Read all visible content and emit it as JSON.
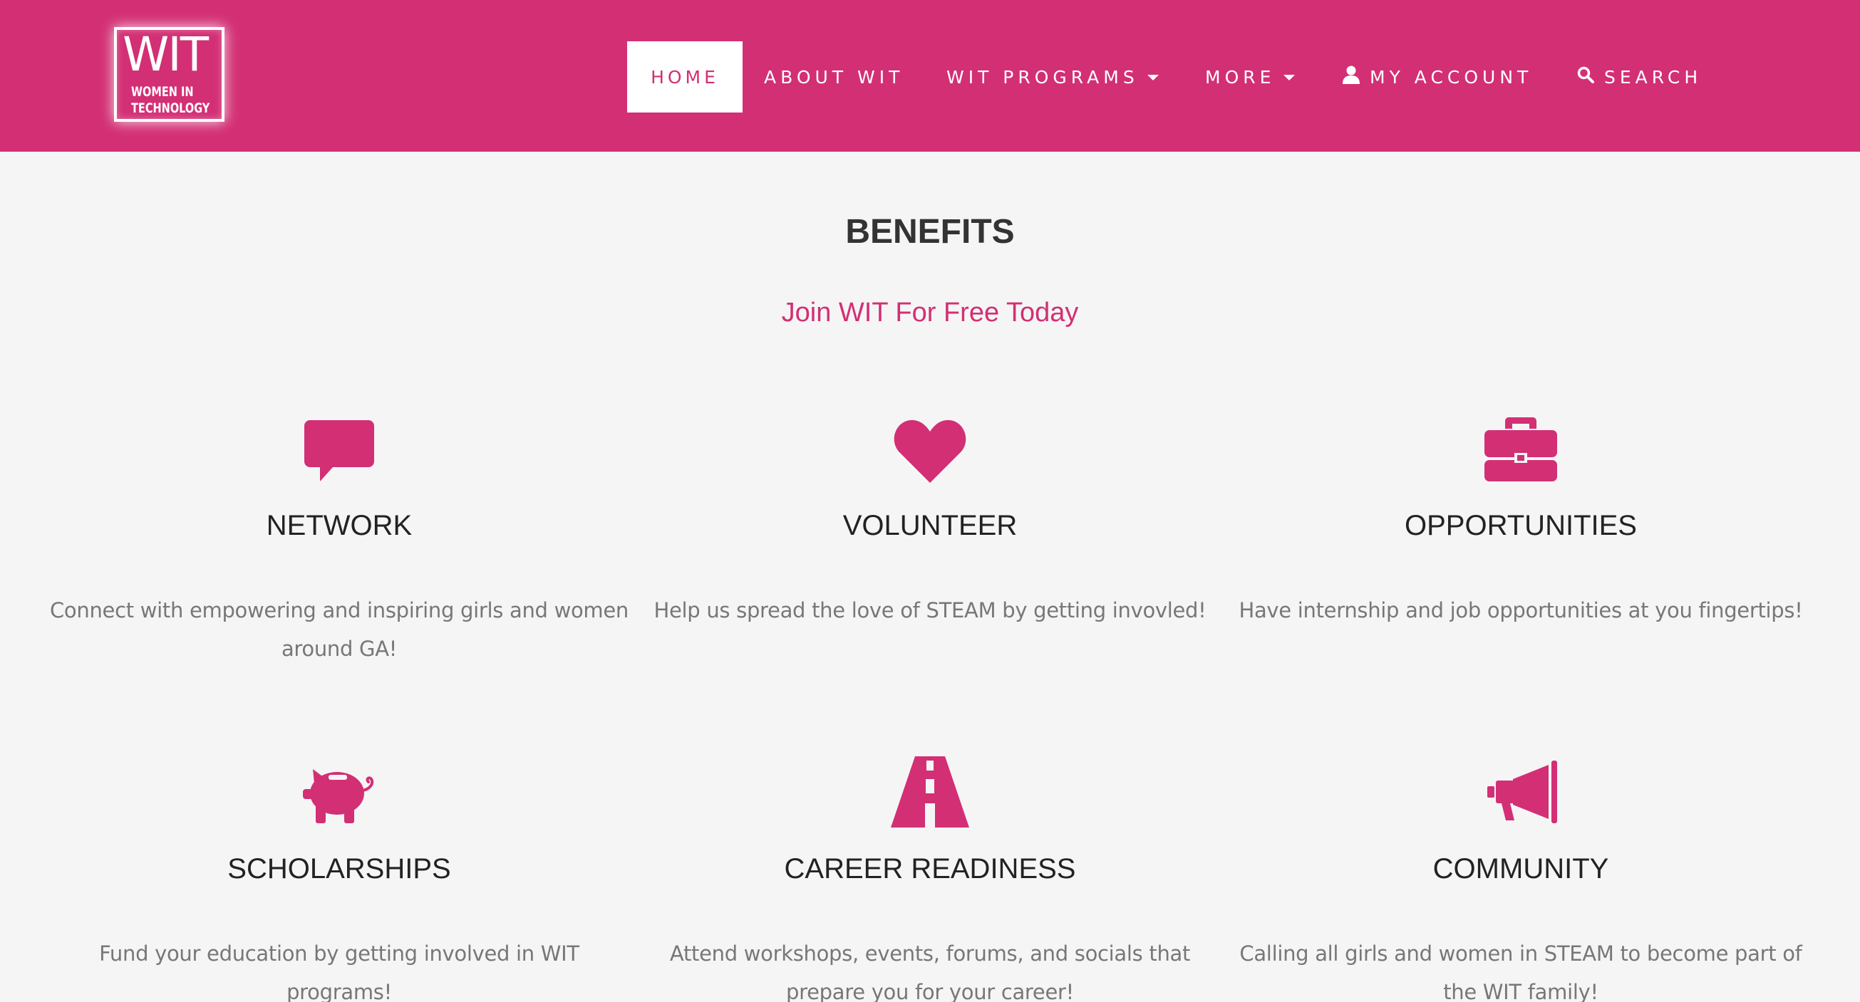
{
  "header": {
    "logo": {
      "title": "WIT",
      "subtitle_line1": "WOMEN IN",
      "subtitle_line2": "TECHNOLOGY"
    },
    "nav": [
      {
        "label": "HOME",
        "active": true
      },
      {
        "label": "ABOUT WIT"
      },
      {
        "label": "WIT PROGRAMS",
        "dropdown": true
      },
      {
        "label": "MORE",
        "dropdown": true
      },
      {
        "label": "MY ACCOUNT",
        "icon": "user-icon"
      },
      {
        "label": "SEARCH",
        "icon": "search-icon"
      }
    ]
  },
  "section": {
    "title": "BENEFITS",
    "subtitle": "Join WIT For Free Today"
  },
  "benefits": [
    {
      "icon": "speech-bubble-icon",
      "title": "NETWORK",
      "description": "Connect with empowering and inspiring girls and women around GA!"
    },
    {
      "icon": "heart-icon",
      "title": "VOLUNTEER",
      "description": "Help us spread the love of STEAM by getting invovled!"
    },
    {
      "icon": "briefcase-icon",
      "title": "OPPORTUNITIES",
      "description": "Have internship and job opportunities at you fingertips!"
    },
    {
      "icon": "piggy-bank-icon",
      "title": "SCHOLARSHIPS",
      "description": "Fund your education by getting involved in WIT programs!"
    },
    {
      "icon": "road-icon",
      "title": "CAREER READINESS",
      "description": "Attend workshops, events, forums, and socials that prepare you for your career!"
    },
    {
      "icon": "megaphone-icon",
      "title": "COMMUNITY",
      "description": "Calling all girls and women in STEAM to become part of the WIT family!"
    }
  ],
  "colors": {
    "brand": "#d32f74",
    "background": "#f5f5f5",
    "text": "#333333",
    "muted": "#777777"
  }
}
